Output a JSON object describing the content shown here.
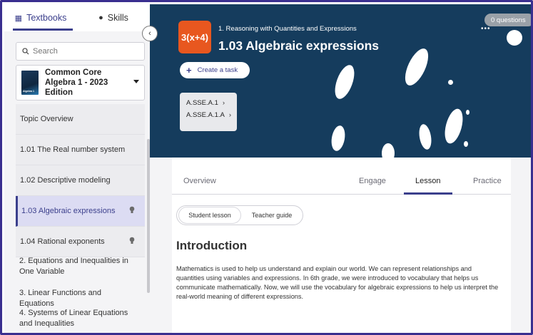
{
  "sidebar": {
    "tabs": [
      {
        "label": "Textbooks",
        "icon": "book-icon"
      },
      {
        "label": "Skills",
        "icon": "skills-icon"
      }
    ],
    "search_placeholder": "Search",
    "book": {
      "title": "Common Core Algebra 1 - 2023 Edition",
      "cover_text": "Algebra 1"
    },
    "topics": [
      {
        "label": "Topic Overview"
      },
      {
        "label": "1.01 The Real number system"
      },
      {
        "label": "1.02 Descriptive modeling"
      },
      {
        "label": "1.03 Algebraic expressions"
      },
      {
        "label": "1.04 Rational exponents"
      }
    ],
    "chapters": [
      {
        "label": "2. Equations and Inequalities in One Variable"
      },
      {
        "label": "3. Linear Functions and Equations"
      },
      {
        "label": "4. Systems of Linear Equations and Inequalities"
      }
    ]
  },
  "hero": {
    "icon_text": "3(x+4)",
    "chapter": "1. Reasoning with Quantities and Expressions",
    "title": "1.03 Algebraic expressions",
    "create_task_label": "Create a task",
    "standards": [
      "A.SSE.A.1",
      "A.SSE.A.1.A"
    ],
    "questions_badge": "0 questions",
    "colors": {
      "background": "#153c5d",
      "icon_bg": "#e8571f"
    }
  },
  "content": {
    "tabs": [
      {
        "label": "Overview"
      },
      {
        "label": "Engage"
      },
      {
        "label": "Lesson"
      },
      {
        "label": "Practice"
      }
    ],
    "toggle": [
      {
        "label": "Student lesson"
      },
      {
        "label": "Teacher guide"
      }
    ],
    "heading": "Introduction",
    "body": "Mathematics is used to help us understand and explain our world. We can represent relationships and quantities using variables and expressions. In 6th grade, we were introduced to vocabulary that helps us communicate mathematically. Now, we will use the vocabulary for algebraic expressions to help us interpret the real-world meaning of different expressions."
  },
  "accent_color": "#3b3f8c"
}
